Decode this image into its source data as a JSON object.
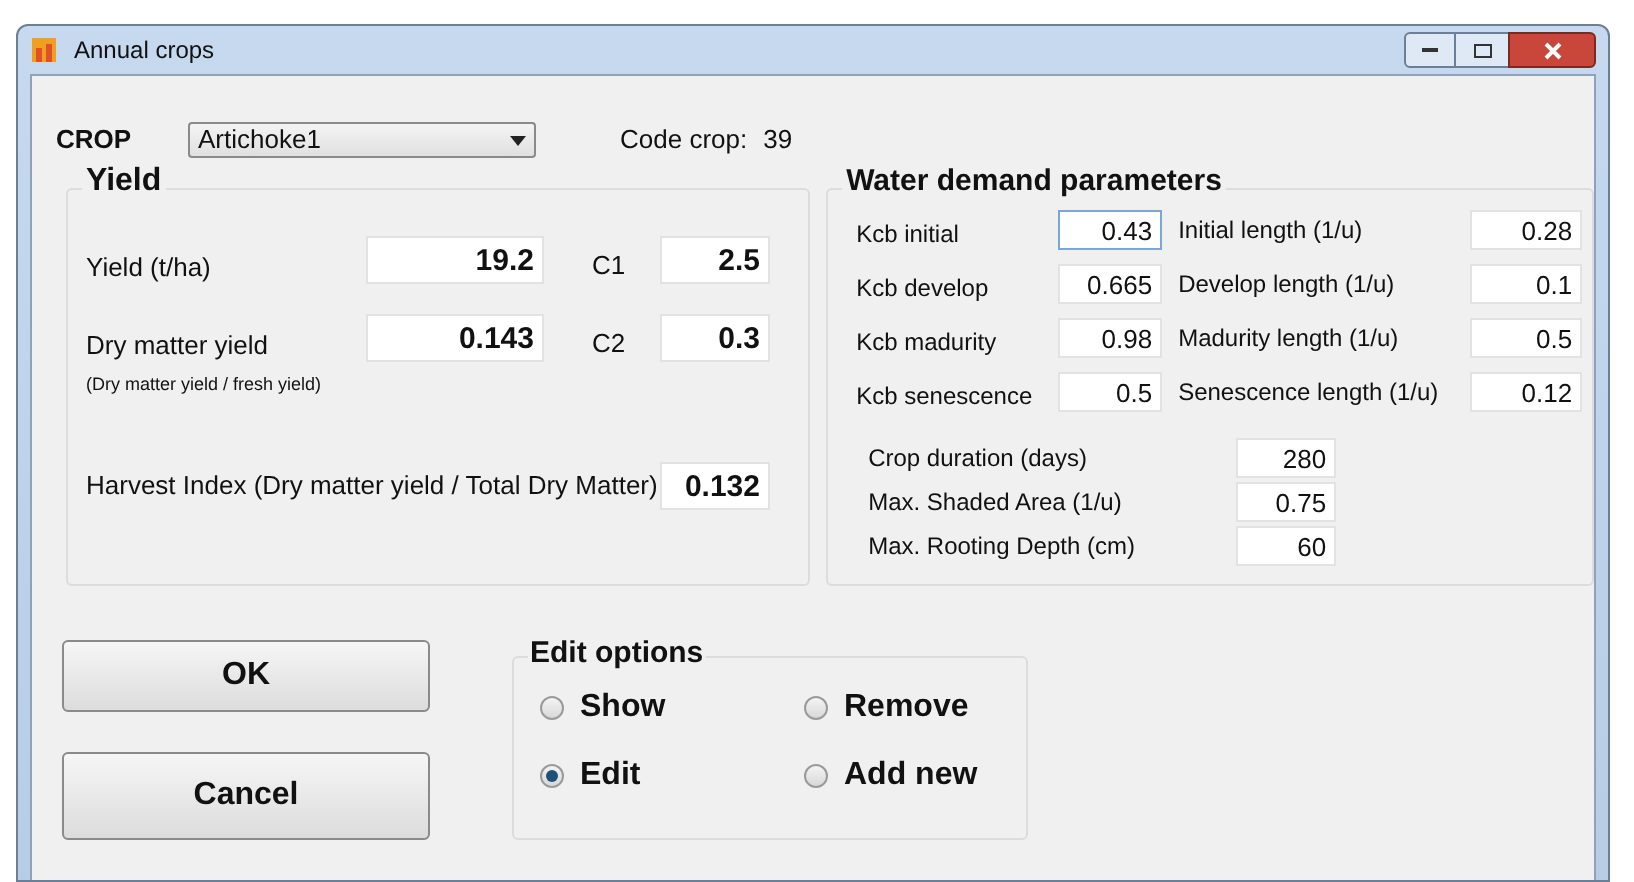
{
  "window": {
    "title": "Annual crops"
  },
  "crop": {
    "label": "CROP",
    "value": "Artichoke1",
    "code_label": "Code crop:",
    "code": "39"
  },
  "yield": {
    "title": "Yield",
    "rows": [
      {
        "label": "Yield (t/ha)",
        "value": "19.2",
        "coef_label": "C1",
        "coef": "2.5"
      },
      {
        "label": "Dry matter yield",
        "note": "(Dry matter yield / fresh yield)",
        "value": "0.143",
        "coef_label": "C2",
        "coef": "0.3"
      }
    ],
    "harvest_label": "Harvest Index (Dry matter yield / Total Dry Matter)",
    "harvest_value": "0.132"
  },
  "water": {
    "title": "Water demand parameters",
    "rows": [
      {
        "label": "Kcb initial",
        "value": "0.43",
        "focused": true,
        "length_label": "Initial length (1/u)",
        "length": "0.28"
      },
      {
        "label": "Kcb develop",
        "value": "0.665",
        "focused": false,
        "length_label": "Develop length (1/u)",
        "length": "0.1"
      },
      {
        "label": "Kcb madurity",
        "value": "0.98",
        "focused": false,
        "length_label": "Madurity length (1/u)",
        "length": "0.5"
      },
      {
        "label": "Kcb senescence",
        "value": "0.5",
        "focused": false,
        "length_label": "Senescence length (1/u)",
        "length": "0.12"
      }
    ],
    "extra": [
      {
        "label": "Crop duration (days)",
        "value": "280"
      },
      {
        "label": "Max. Shaded Area (1/u)",
        "value": "0.75"
      },
      {
        "label": "Max. Rooting Depth (cm)",
        "value": "60"
      }
    ]
  },
  "buttons": [
    "OK",
    "Cancel"
  ],
  "edit_options": {
    "title": "Edit options",
    "options": [
      {
        "label": "Show",
        "selected": false
      },
      {
        "label": "Remove",
        "selected": false
      },
      {
        "label": "Edit",
        "selected": true
      },
      {
        "label": "Add new",
        "selected": false
      }
    ]
  }
}
